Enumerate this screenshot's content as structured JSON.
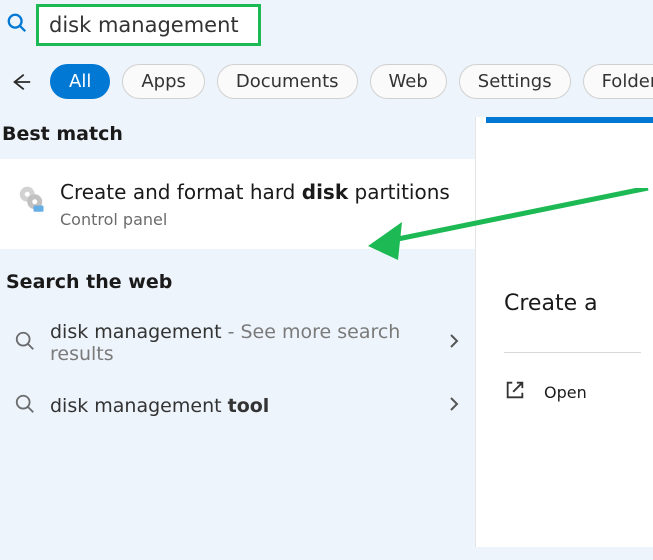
{
  "search": {
    "value": "disk management"
  },
  "filters": {
    "all": "All",
    "apps": "Apps",
    "documents": "Documents",
    "web": "Web",
    "settings": "Settings",
    "folders": "Folders"
  },
  "sections": {
    "best_match": "Best match",
    "search_web": "Search the web"
  },
  "best": {
    "title_pre": "Create and format hard ",
    "title_bold": "disk",
    "title_post": " partitions",
    "subtitle": "Control panel"
  },
  "web": {
    "item1_pre": "disk management",
    "item1_post": " - See more search results",
    "item2_pre": "disk management ",
    "item2_bold": "tool"
  },
  "right": {
    "title": "Create a",
    "open": "Open"
  }
}
